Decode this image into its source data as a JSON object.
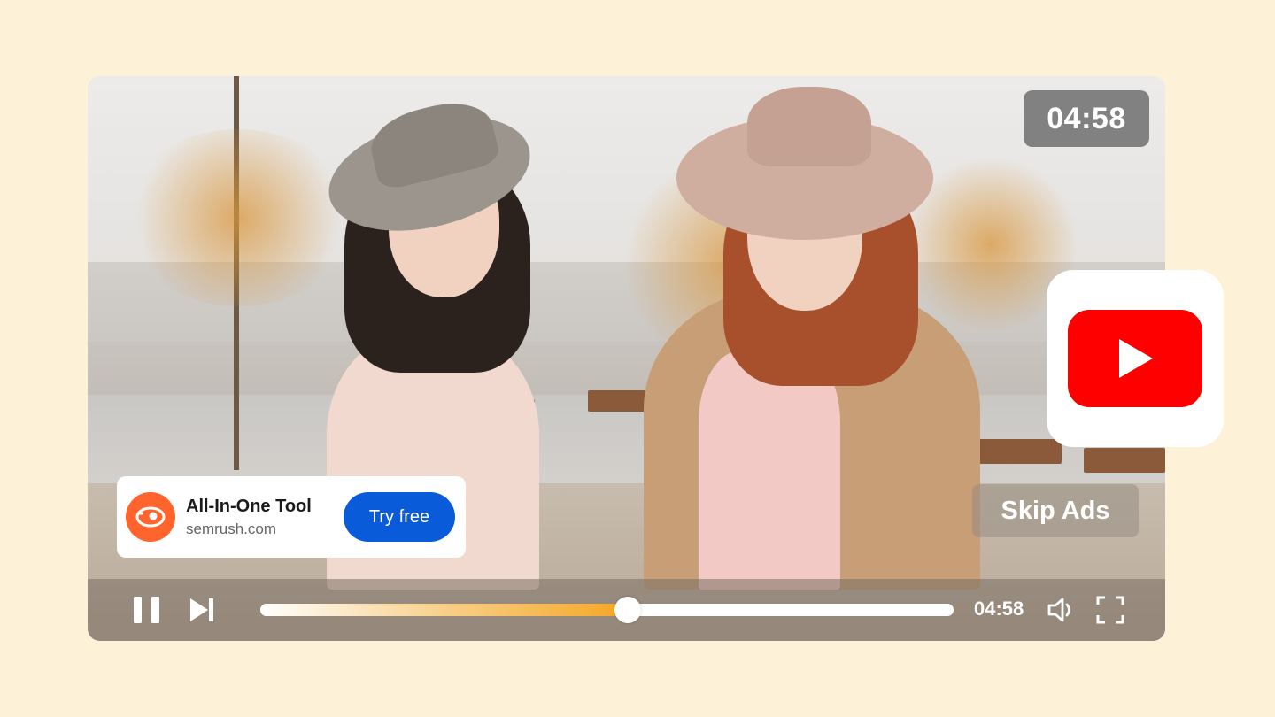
{
  "player": {
    "ad_countdown": "04:58",
    "skip_label": "Skip Ads",
    "current_time": "04:58",
    "progress": 0.53
  },
  "ad": {
    "title": "All-In-One Tool",
    "domain": "semrush.com",
    "cta_label": "Try free"
  },
  "colors": {
    "background": "#fdf1d8",
    "youtube_red": "#ff0000",
    "cta_blue": "#0a5bd9",
    "semrush_orange": "#ff642d",
    "progress_accent": "#f5a623"
  },
  "icons": {
    "play_pause": "pause-icon",
    "next": "skip-next-icon",
    "volume": "volume-icon",
    "fullscreen": "fullscreen-icon",
    "brand": "youtube-logo-icon",
    "advertiser": "semrush-logo-icon"
  }
}
